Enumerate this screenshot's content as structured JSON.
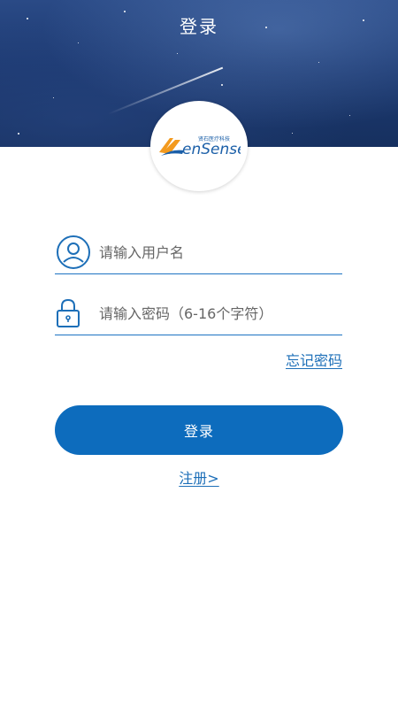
{
  "header": {
    "title": "登录"
  },
  "logo": {
    "brand_text": "enSense",
    "tagline": "贤石医疗科技",
    "colors": {
      "orange": "#f39a1e",
      "blue": "#1b5fa8"
    }
  },
  "form": {
    "username": {
      "value": "",
      "placeholder": "请输入用户名",
      "icon": "user-icon"
    },
    "password": {
      "value": "",
      "placeholder": "请输入密码（6-16个字符）",
      "icon": "lock-icon"
    },
    "forgot_label": "忘记密码",
    "login_label": "登录",
    "register_label": "注册>"
  },
  "colors": {
    "accent": "#0d6cbd",
    "link": "#1d6fb8",
    "header_bg": "#1d3a72"
  }
}
